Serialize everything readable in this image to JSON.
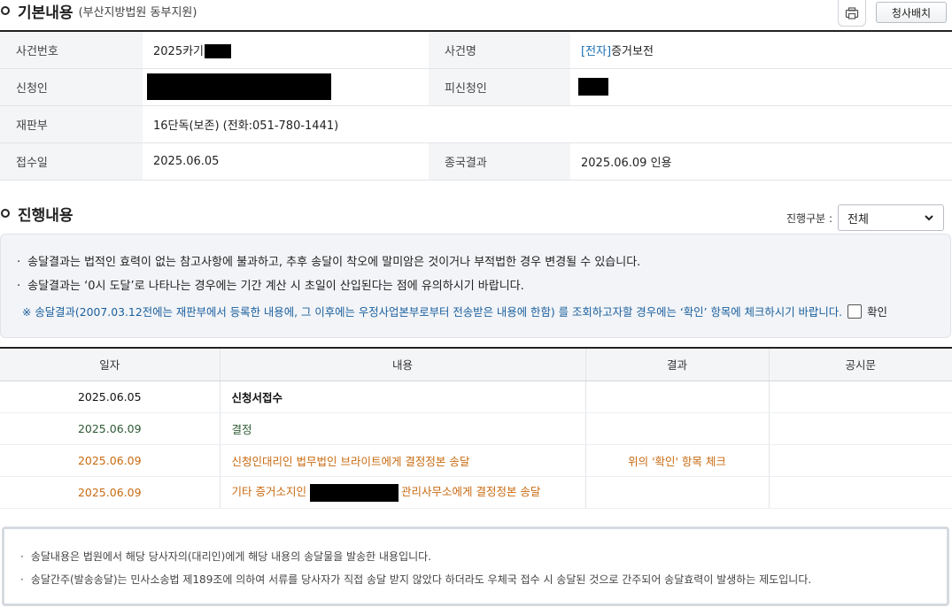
{
  "basic": {
    "title": "기본내용",
    "court": "(부산지방법원 동부지원)",
    "assign_button": "청사배치",
    "rows": {
      "case_no_label": "사건번호",
      "case_no_value": "2025카기",
      "case_name_label": "사건명",
      "case_name_link": "[전자]",
      "case_name_value": "증거보전",
      "applicant_label": "신청인",
      "respondent_label": "피신청인",
      "court_div_label": "재판부",
      "court_div_value": "16단독(보존) (전화:051-780-1441)",
      "received_label": "접수일",
      "received_value": "2025.06.05",
      "final_label": "종국결과",
      "final_value": "2025.06.09 인용"
    }
  },
  "progress": {
    "title": "진행내용",
    "filter_label": "진행구분 :",
    "filter_value": "전체",
    "notices": [
      "송달결과는 법적인 효력이 없는 참고사항에 불과하고, 추후 송달이 착오에 말미암은 것이거나 부적법한 경우 변경될 수 있습니다.",
      "송달결과는 ‘0시 도달’로 나타나는 경우에는 기간 계산 시 초일이 산입된다는 점에 유의하시기 바랍니다."
    ],
    "blue_notice": "※ 송달결과(2007.03.12전에는 재판부에서 등록한 내용에, 그 이후에는 우정사업본부로부터 전송받은 내용에 한함) 를 조회하고자할 경우에는 ‘확인’ 항목에 체크하시기 바랍니다.",
    "confirm_label": "확인",
    "table": {
      "headers": [
        "일자",
        "내용",
        "결과",
        "공시문"
      ],
      "rows": [
        {
          "date": "2025.06.05",
          "content": "신청서접수",
          "result": "",
          "notice": ""
        },
        {
          "date": "2025.06.09",
          "content": "결정",
          "result": "",
          "notice": ""
        },
        {
          "date": "2025.06.09",
          "content": "신청인대리인 법무법인 브라이트에게 결정정본 송달",
          "result": "위의 '확인' 항목 체크",
          "notice": ""
        },
        {
          "date": "2025.06.09",
          "content_before": "기타 증거소지인",
          "content_after": "관리사무소에게 결정정본 송달",
          "result": "",
          "notice": ""
        }
      ]
    }
  },
  "bottom": {
    "lines": [
      "송달내용은 법원에서 해당 당사자의(대리인)에게 해당 내용의 송달물을 발송한 내용입니다.",
      "송달간주(발송송달)는 민사소송법 제189조에 의하여 서류를 당사자가 직접 송달 받지 않았다 하더라도 우체국 접수 시 송달된 것으로 간주되어 송달효력이 발생하는 제도입니다."
    ]
  },
  "colors": {
    "link_blue": "#1a6fb4",
    "notice_blue": "#1a5f9e",
    "status_green": "#2f5a33",
    "status_orange": "#c96a10"
  }
}
